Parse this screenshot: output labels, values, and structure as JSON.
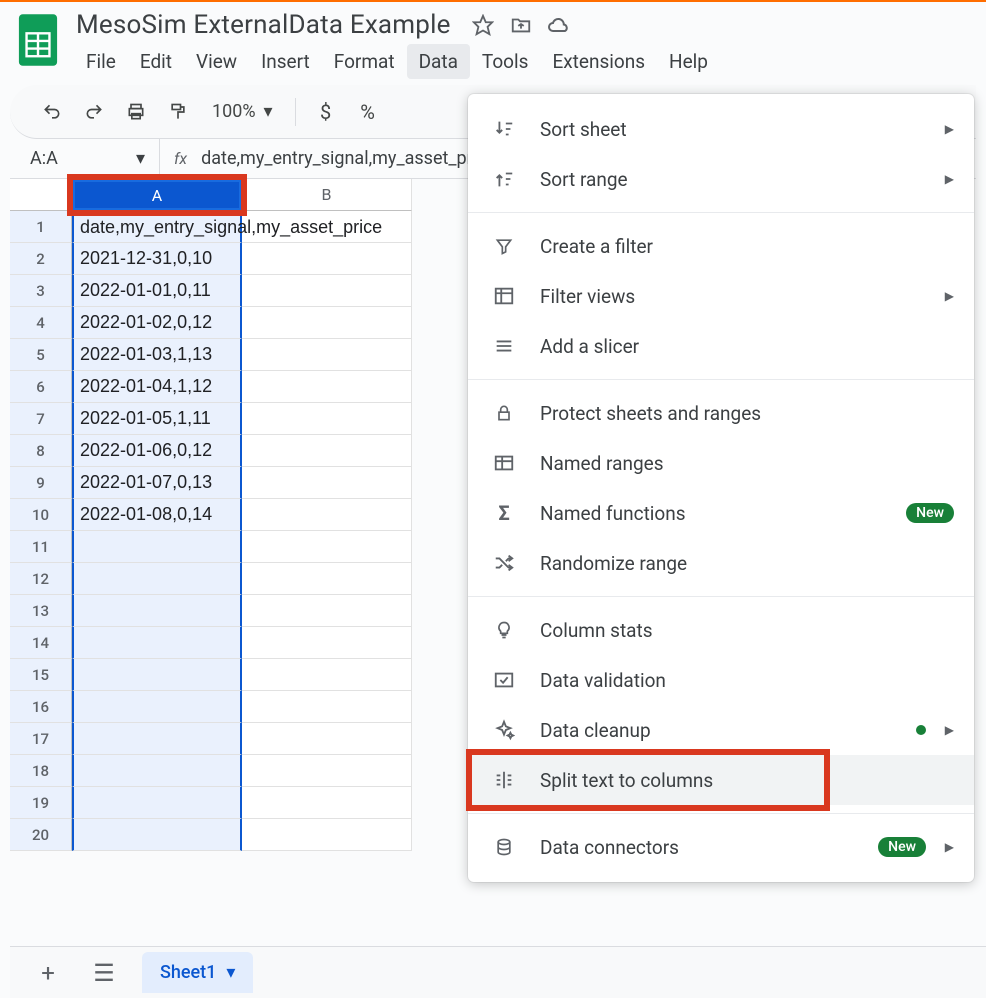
{
  "doc": {
    "title": "MesoSim ExternalData Example"
  },
  "menu": {
    "items": [
      "File",
      "Edit",
      "View",
      "Insert",
      "Format",
      "Data",
      "Tools",
      "Extensions",
      "Help"
    ],
    "active": "Data"
  },
  "toolbar": {
    "zoom": "100%",
    "currency": "$",
    "percent": "%"
  },
  "formula": {
    "name_box": "A:A",
    "text": "date,my_entry_signal,my_asset_price"
  },
  "columns": [
    "A",
    "B"
  ],
  "rows": [
    {
      "n": 1,
      "a": "date,my_entry_signal,my_asset_price"
    },
    {
      "n": 2,
      "a": "2021-12-31,0,10"
    },
    {
      "n": 3,
      "a": "2022-01-01,0,11"
    },
    {
      "n": 4,
      "a": "2022-01-02,0,12"
    },
    {
      "n": 5,
      "a": "2022-01-03,1,13"
    },
    {
      "n": 6,
      "a": "2022-01-04,1,12"
    },
    {
      "n": 7,
      "a": "2022-01-05,1,11"
    },
    {
      "n": 8,
      "a": "2022-01-06,0,12"
    },
    {
      "n": 9,
      "a": "2022-01-07,0,13"
    },
    {
      "n": 10,
      "a": "2022-01-08,0,14"
    },
    {
      "n": 11,
      "a": ""
    },
    {
      "n": 12,
      "a": ""
    },
    {
      "n": 13,
      "a": ""
    },
    {
      "n": 14,
      "a": ""
    },
    {
      "n": 15,
      "a": ""
    },
    {
      "n": 16,
      "a": ""
    },
    {
      "n": 17,
      "a": ""
    },
    {
      "n": 18,
      "a": ""
    },
    {
      "n": 19,
      "a": ""
    },
    {
      "n": 20,
      "a": ""
    }
  ],
  "data_menu": {
    "groups": [
      [
        {
          "id": "sort-sheet",
          "label": "Sort sheet",
          "icon": "sort-sheet",
          "arrow": true
        },
        {
          "id": "sort-range",
          "label": "Sort range",
          "icon": "sort-range",
          "arrow": true
        }
      ],
      [
        {
          "id": "create-filter",
          "label": "Create a filter",
          "icon": "filter"
        },
        {
          "id": "filter-views",
          "label": "Filter views",
          "icon": "filter-views",
          "arrow": true
        },
        {
          "id": "add-slicer",
          "label": "Add a slicer",
          "icon": "slicer"
        }
      ],
      [
        {
          "id": "protect",
          "label": "Protect sheets and ranges",
          "icon": "lock"
        },
        {
          "id": "named-ranges",
          "label": "Named ranges",
          "icon": "named-ranges"
        },
        {
          "id": "named-functions",
          "label": "Named functions",
          "icon": "sigma",
          "badge": "New"
        },
        {
          "id": "randomize",
          "label": "Randomize range",
          "icon": "shuffle"
        }
      ],
      [
        {
          "id": "column-stats",
          "label": "Column stats",
          "icon": "bulb"
        },
        {
          "id": "data-validation",
          "label": "Data validation",
          "icon": "validation"
        },
        {
          "id": "data-cleanup",
          "label": "Data cleanup",
          "icon": "sparkle",
          "arrow": true,
          "dot": true
        },
        {
          "id": "split-text",
          "label": "Split text to columns",
          "icon": "split",
          "hover": true,
          "redbox": true
        }
      ],
      [
        {
          "id": "data-connectors",
          "label": "Data connectors",
          "icon": "database",
          "arrow": true,
          "badge": "New"
        }
      ]
    ]
  },
  "tabs": {
    "sheet1": "Sheet1"
  }
}
